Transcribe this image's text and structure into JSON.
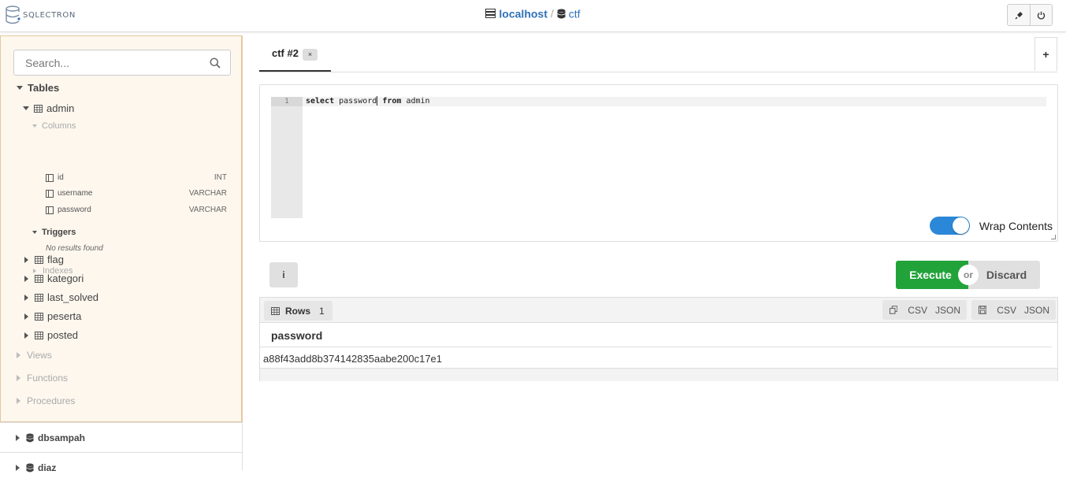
{
  "app": {
    "logo_text": "SQLECTRON"
  },
  "breadcrumb": {
    "server": "localhost",
    "database": "ctf"
  },
  "sidebar": {
    "search_placeholder": "Search...",
    "tables_label": "Tables",
    "admin": {
      "name": "admin",
      "columns_label": "Columns",
      "columns": [
        {
          "name": "id",
          "type": "INT"
        },
        {
          "name": "username",
          "type": "VARCHAR"
        },
        {
          "name": "password",
          "type": "VARCHAR"
        }
      ],
      "triggers_label": "Triggers",
      "no_results": "No results found",
      "indexes_label": "Indexes"
    },
    "other_tables": [
      "flag",
      "kategori",
      "last_solved",
      "peserta",
      "posted"
    ],
    "sections": [
      "Views",
      "Functions",
      "Procedures"
    ],
    "databases": [
      "dbsampah",
      "diaz"
    ]
  },
  "tabs": [
    {
      "title": "ctf #2",
      "close": "×"
    }
  ],
  "add_tab": "+",
  "editor": {
    "line_number": "1",
    "code": {
      "kw1": "select",
      "col": " password",
      "kw2": "from",
      "table": " admin"
    },
    "wrap_label": "Wrap Contents"
  },
  "actions": {
    "info": "i",
    "execute": "Execute",
    "or": "or",
    "discard": "Discard"
  },
  "results": {
    "rows_label": "Rows",
    "row_count": "1",
    "copy_csv": "CSV",
    "copy_json": "JSON",
    "save_csv": "CSV",
    "save_json": "JSON",
    "column": "password",
    "value": "a88f43add8b374142835aabe200c17e1"
  }
}
